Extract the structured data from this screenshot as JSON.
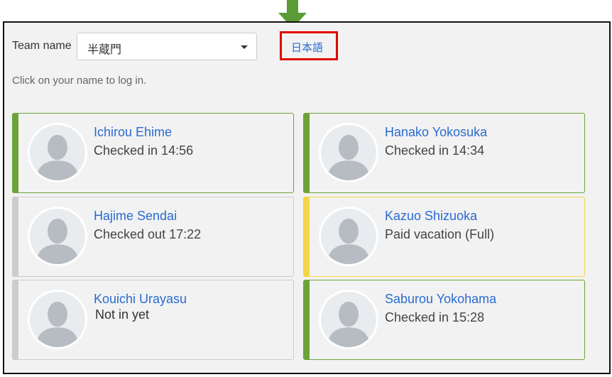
{
  "header": {
    "team_label": "Team name",
    "team_value": "半蔵門",
    "language_link": "日本語",
    "hint": "Click on your name to log in."
  },
  "colors": {
    "checked_in": "#6ba33a",
    "checked_out": "#cccccc",
    "vacation": "#f2d648",
    "link": "#2a6bd1",
    "highlight": "#e00000",
    "arrow": "#5b9b35"
  },
  "members": [
    {
      "name": "Ichirou Ehime",
      "status": "Checked in 14:56",
      "state": "checked_in"
    },
    {
      "name": "Hanako Yokosuka",
      "status": "Checked in 14:34",
      "state": "checked_in"
    },
    {
      "name": "Hajime Sendai",
      "status": "Checked out 17:22",
      "state": "checked_out"
    },
    {
      "name": "Kazuo Shizuoka",
      "status": "Paid vacation (Full)",
      "state": "vacation"
    },
    {
      "name": "Kouichi Urayasu",
      "status": "Not in yet",
      "state": "not_in"
    },
    {
      "name": "Saburou Yokohama",
      "status": "Checked in 15:28",
      "state": "checked_in"
    }
  ]
}
